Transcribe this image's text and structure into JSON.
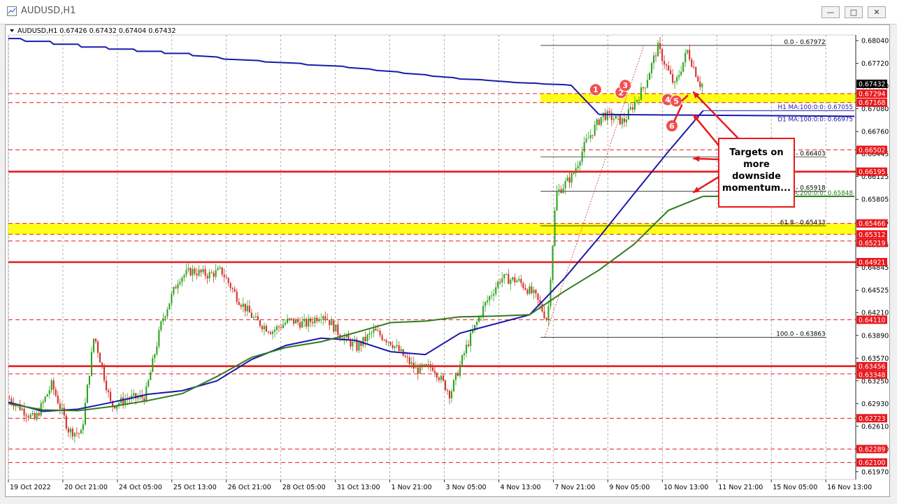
{
  "window": {
    "title": "AUDUSD,H1"
  },
  "chart_data": {
    "type": "candlestick",
    "symbol_header": "AUDUSD,H1  0.67426 0.67432 0.67404 0.67432",
    "ylim": [
      0.6186,
      0.6812
    ],
    "y_ticks": [
      "0.68040",
      "0.67720",
      "0.67400",
      "0.67080",
      "0.66760",
      "0.66445",
      "0.66125",
      "0.65805",
      "0.65485",
      "0.65165",
      "0.64845",
      "0.64525",
      "0.64210",
      "0.63890",
      "0.63570",
      "0.63250",
      "0.62930",
      "0.62610",
      "0.62290",
      "0.61970"
    ],
    "x_ticks": [
      "19 Oct 2022",
      "20 Oct 21:00",
      "24 Oct 05:00",
      "25 Oct 13:00",
      "26 Oct 21:00",
      "28 Oct 05:00",
      "31 Oct 13:00",
      "1 Nov 21:00",
      "3 Nov 05:00",
      "4 Nov 13:00",
      "7 Nov 21:00",
      "9 Nov 05:00",
      "10 Nov 13:00",
      "11 Nov 21:00",
      "15 Nov 05:00",
      "16 Nov 13:00"
    ],
    "price_tags": [
      {
        "value": 0.67432,
        "label": "0.67432",
        "bg": "#000000",
        "fg": "#ffffff"
      },
      {
        "value": 0.67294,
        "label": "0.67294",
        "bg": "#e8191d",
        "fg": "#ffffff"
      },
      {
        "value": 0.67168,
        "label": "0.67168",
        "bg": "#e8191d",
        "fg": "#ffffff"
      },
      {
        "value": 0.66502,
        "label": "0.66502",
        "bg": "#e8191d",
        "fg": "#ffffff"
      },
      {
        "value": 0.66195,
        "label": "0.66195",
        "bg": "#e8191d",
        "fg": "#ffffff"
      },
      {
        "value": 0.65466,
        "label": "0.65466",
        "bg": "#e8191d",
        "fg": "#ffffff"
      },
      {
        "value": 0.65312,
        "label": "0.65312",
        "bg": "#e8191d",
        "fg": "#ffffff"
      },
      {
        "value": 0.65219,
        "label": "0.65219",
        "bg": "#e8191d",
        "fg": "#ffffff"
      },
      {
        "value": 0.64921,
        "label": "0.64921",
        "bg": "#e8191d",
        "fg": "#ffffff"
      },
      {
        "value": 0.6411,
        "label": "0.64110",
        "bg": "#e8191d",
        "fg": "#ffffff"
      },
      {
        "value": 0.63456,
        "label": "0.63456",
        "bg": "#e8191d",
        "fg": "#ffffff"
      },
      {
        "value": 0.63348,
        "label": "0.63348",
        "bg": "#e8191d",
        "fg": "#ffffff"
      },
      {
        "value": 0.62723,
        "label": "0.62723",
        "bg": "#e8191d",
        "fg": "#ffffff"
      },
      {
        "value": 0.62289,
        "label": "0.62289",
        "bg": "#e8191d",
        "fg": "#ffffff"
      },
      {
        "value": 0.621,
        "label": "0.62100",
        "bg": "#e8191d",
        "fg": "#ffffff"
      }
    ],
    "horizontal_levels": [
      {
        "value": 0.67294,
        "style": "dashed"
      },
      {
        "value": 0.67168,
        "style": "dashed"
      },
      {
        "value": 0.66502,
        "style": "dashed"
      },
      {
        "value": 0.66195,
        "style": "solid"
      },
      {
        "value": 0.65466,
        "style": "dashed"
      },
      {
        "value": 0.65312,
        "style": "dashed"
      },
      {
        "value": 0.65219,
        "style": "dashed"
      },
      {
        "value": 0.64921,
        "style": "solid"
      },
      {
        "value": 0.6411,
        "style": "dashed"
      },
      {
        "value": 0.63456,
        "style": "solid"
      },
      {
        "value": 0.63348,
        "style": "dashed"
      },
      {
        "value": 0.62723,
        "style": "dashed"
      },
      {
        "value": 0.62289,
        "style": "dashed"
      },
      {
        "value": 0.621,
        "style": "dashed"
      }
    ],
    "support_zones": [
      {
        "low": 0.67168,
        "high": 0.67294,
        "from": 0.628,
        "to": 1.0
      },
      {
        "low": 0.65312,
        "high": 0.65466,
        "from": 0.0,
        "to": 1.0
      }
    ],
    "fibonacci": [
      {
        "label": "0.0 - 0.67972",
        "value": 0.67972
      },
      {
        "label": "38.2 - 0.66403",
        "value": 0.66403
      },
      {
        "label": "50.0 - 0.65918",
        "value": 0.65918
      },
      {
        "label": "61.8 - 0.65433",
        "value": 0.65433
      },
      {
        "label": "100.0 - 0.63863",
        "value": 0.63863
      }
    ],
    "ma_labels": [
      {
        "label": "H1 MA:100:0:0: 0.67055",
        "value": 0.67055
      },
      {
        "label": "D1 MA:100:0:0: 0.66975",
        "value": 0.66975
      },
      {
        "label": "MA:200:0:0: 0.65848",
        "value": 0.65848
      }
    ],
    "series": [
      {
        "type": "line",
        "color": "#1a1aaa",
        "x": [
          0,
          0.017,
          0.025,
          0.06,
          0.065,
          0.1,
          0.105,
          0.14,
          0.145,
          0.18,
          0.185,
          0.22,
          0.225,
          0.26,
          0.265,
          0.3,
          0.31,
          0.36,
          0.37,
          0.42,
          0.43,
          0.48,
          0.49,
          0.52,
          0.53,
          0.56,
          0.57,
          0.6,
          0.61,
          0.64,
          0.65,
          0.68,
          0.69,
          0.72,
          0.73,
          0.76,
          0.77,
          0.8,
          0.81,
          0.85
        ],
        "y": [
          0.6807,
          0.6807,
          0.6803,
          0.6803,
          0.6799,
          0.6799,
          0.6795,
          0.6795,
          0.6792,
          0.6792,
          0.6789,
          0.6789,
          0.6786,
          0.6786,
          0.6783,
          0.6781,
          0.6778,
          0.6776,
          0.6774,
          0.6772,
          0.677,
          0.6768,
          0.6766,
          0.6764,
          0.6762,
          0.676,
          0.6758,
          0.6756,
          0.6754,
          0.6752,
          0.675,
          0.6749,
          0.6748,
          0.6746,
          0.6745,
          0.6744,
          0.6743,
          0.6742,
          0.6741,
          0.67
        ]
      },
      {
        "type": "line",
        "color": "#1a1aaa",
        "x": [
          0.0,
          0.05,
          0.1,
          0.15,
          0.2,
          0.25,
          0.3,
          0.35,
          0.4,
          0.45,
          0.5,
          0.55,
          0.6,
          0.65,
          0.7,
          0.75,
          0.8,
          0.85,
          0.9,
          0.95,
          1.0
        ],
        "y": [
          0.6295,
          0.6282,
          0.6285,
          0.6295,
          0.6306,
          0.6311,
          0.6325,
          0.6355,
          0.6375,
          0.6385,
          0.6382,
          0.6366,
          0.6362,
          0.6392,
          0.6405,
          0.6418,
          0.6469,
          0.6527,
          0.6588,
          0.6648,
          0.67055
        ]
      },
      {
        "type": "line",
        "color": "#2e7d1e",
        "x": [
          0.0,
          0.05,
          0.1,
          0.15,
          0.2,
          0.25,
          0.3,
          0.35,
          0.4,
          0.45,
          0.5,
          0.55,
          0.6,
          0.65,
          0.7,
          0.75,
          0.8,
          0.85,
          0.9,
          0.95,
          1.0
        ],
        "y": [
          0.6293,
          0.6284,
          0.6283,
          0.6289,
          0.6297,
          0.6307,
          0.6331,
          0.6358,
          0.6372,
          0.638,
          0.6393,
          0.6407,
          0.6409,
          0.6415,
          0.6416,
          0.6418,
          0.6451,
          0.6481,
          0.6517,
          0.6565,
          0.65848
        ]
      }
    ],
    "callouts": [
      {
        "label": "Targets on more downside momentum..."
      }
    ],
    "markers": [
      {
        "label": "1",
        "value": 0.6735
      },
      {
        "label": "2",
        "value": 0.6731
      },
      {
        "label": "3",
        "value": 0.6741
      },
      {
        "label": "4",
        "value": 0.6721
      },
      {
        "label": "5",
        "value": 0.6719
      },
      {
        "label": "6",
        "value": 0.6684
      }
    ],
    "colors": {
      "bull": "#2ea41e",
      "bear": "#d4302a",
      "level": "#e8191d",
      "zone": "#ffff00",
      "ma_blue": "#1a1aaa",
      "ma_green": "#2e7d1e",
      "fib": "#000000"
    }
  }
}
